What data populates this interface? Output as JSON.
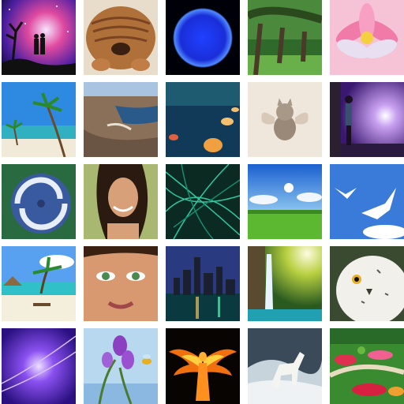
{
  "gallery": {
    "rows": 5,
    "columns": 5,
    "tiles": [
      {
        "subject": "couple-silhouette-galaxy"
      },
      {
        "subject": "shar-pei-puppy"
      },
      {
        "subject": "blue-sun"
      },
      {
        "subject": "oak-tree-avenue"
      },
      {
        "subject": "pink-lotus-flower"
      },
      {
        "subject": "tropical-beach-palm"
      },
      {
        "subject": "dam-canyon-aerial"
      },
      {
        "subject": "glass-igloos-night"
      },
      {
        "subject": "winged-kitten"
      },
      {
        "subject": "person-moonlit-purple-sky"
      },
      {
        "subject": "hurricane-from-space"
      },
      {
        "subject": "smiling-woman-portrait"
      },
      {
        "subject": "green-light-fibers"
      },
      {
        "subject": "green-field-blue-sky"
      },
      {
        "subject": "white-doves-sky"
      },
      {
        "subject": "beach-hut-palms"
      },
      {
        "subject": "woman-eyes-closeup"
      },
      {
        "subject": "city-skyline-night"
      },
      {
        "subject": "waterfall-sunlight"
      },
      {
        "subject": "snowy-owl"
      },
      {
        "subject": "purple-light-abstract"
      },
      {
        "subject": "orchid-and-bee"
      },
      {
        "subject": "fire-phoenix-woman"
      },
      {
        "subject": "white-horse-waves"
      },
      {
        "subject": "flower-garden-paths"
      }
    ]
  }
}
